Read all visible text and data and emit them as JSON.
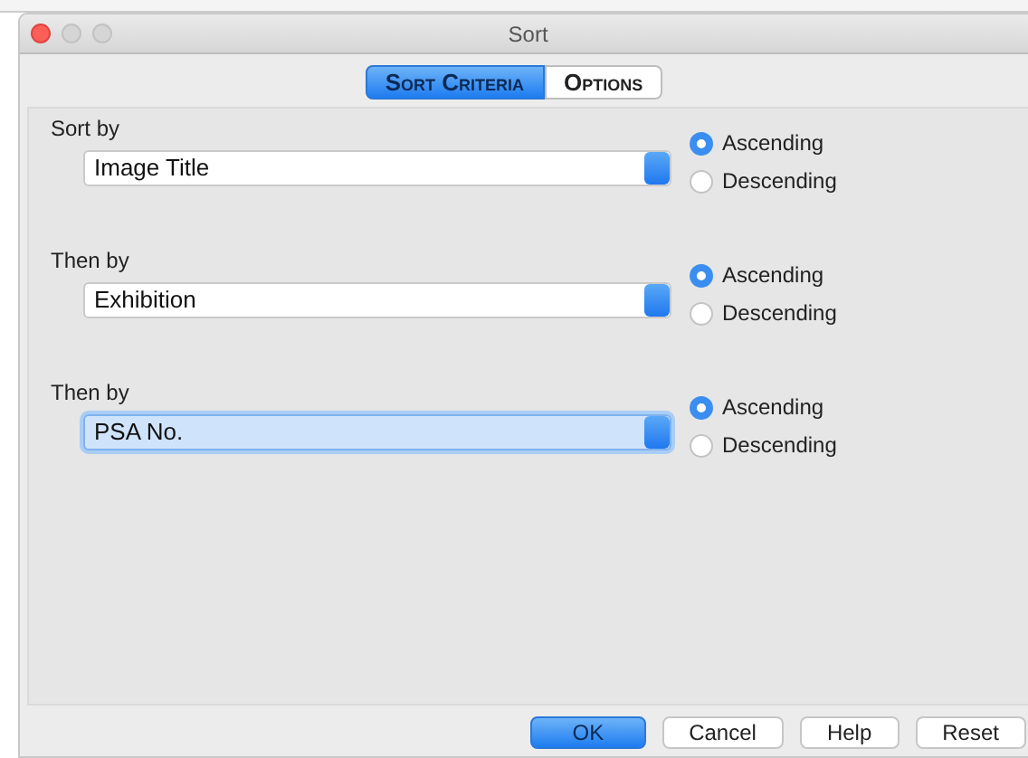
{
  "window": {
    "title": "Sort"
  },
  "tabs": [
    {
      "label": "Sort Criteria",
      "selected": true
    },
    {
      "label": "Options",
      "selected": false
    }
  ],
  "criteria": [
    {
      "label": "Sort by",
      "field": "Image Title",
      "focused": false,
      "orders": [
        {
          "label": "Ascending",
          "selected": true
        },
        {
          "label": "Descending",
          "selected": false
        }
      ]
    },
    {
      "label": "Then by",
      "field": "Exhibition",
      "focused": false,
      "orders": [
        {
          "label": "Ascending",
          "selected": true
        },
        {
          "label": "Descending",
          "selected": false
        }
      ]
    },
    {
      "label": "Then by",
      "field": "PSA No.",
      "focused": true,
      "orders": [
        {
          "label": "Ascending",
          "selected": true
        },
        {
          "label": "Descending",
          "selected": false
        }
      ]
    }
  ],
  "buttons": [
    {
      "label": "OK",
      "default": true
    },
    {
      "label": "Cancel",
      "default": false
    },
    {
      "label": "Help",
      "default": false
    },
    {
      "label": "Reset",
      "default": false
    }
  ]
}
